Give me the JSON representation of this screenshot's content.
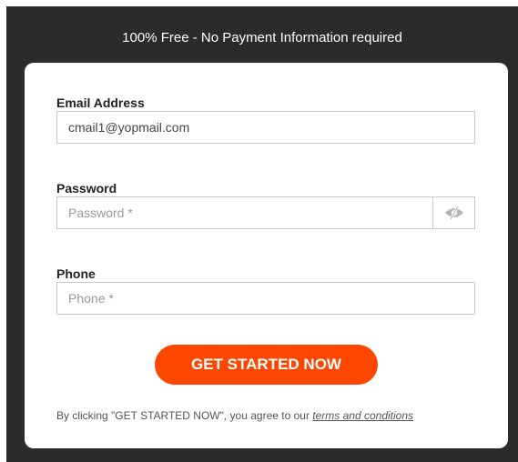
{
  "banner": "100% Free - No Payment Information required",
  "form": {
    "email": {
      "label": "Email Address",
      "value": "cmail1@yopmail.com"
    },
    "password": {
      "label": "Password",
      "placeholder": "Password *",
      "toggle_icon": "eye-slash-icon"
    },
    "phone": {
      "label": "Phone",
      "placeholder": "Phone *"
    },
    "submit_label": "GET STARTED NOW",
    "terms_prefix": "By clicking \"GET STARTED NOW\", you agree to our ",
    "terms_link": "terms and conditions"
  },
  "colors": {
    "background": "#2b2b2b",
    "card": "#ffffff",
    "accent": "#fb4700",
    "border": "#c9c9c9"
  }
}
